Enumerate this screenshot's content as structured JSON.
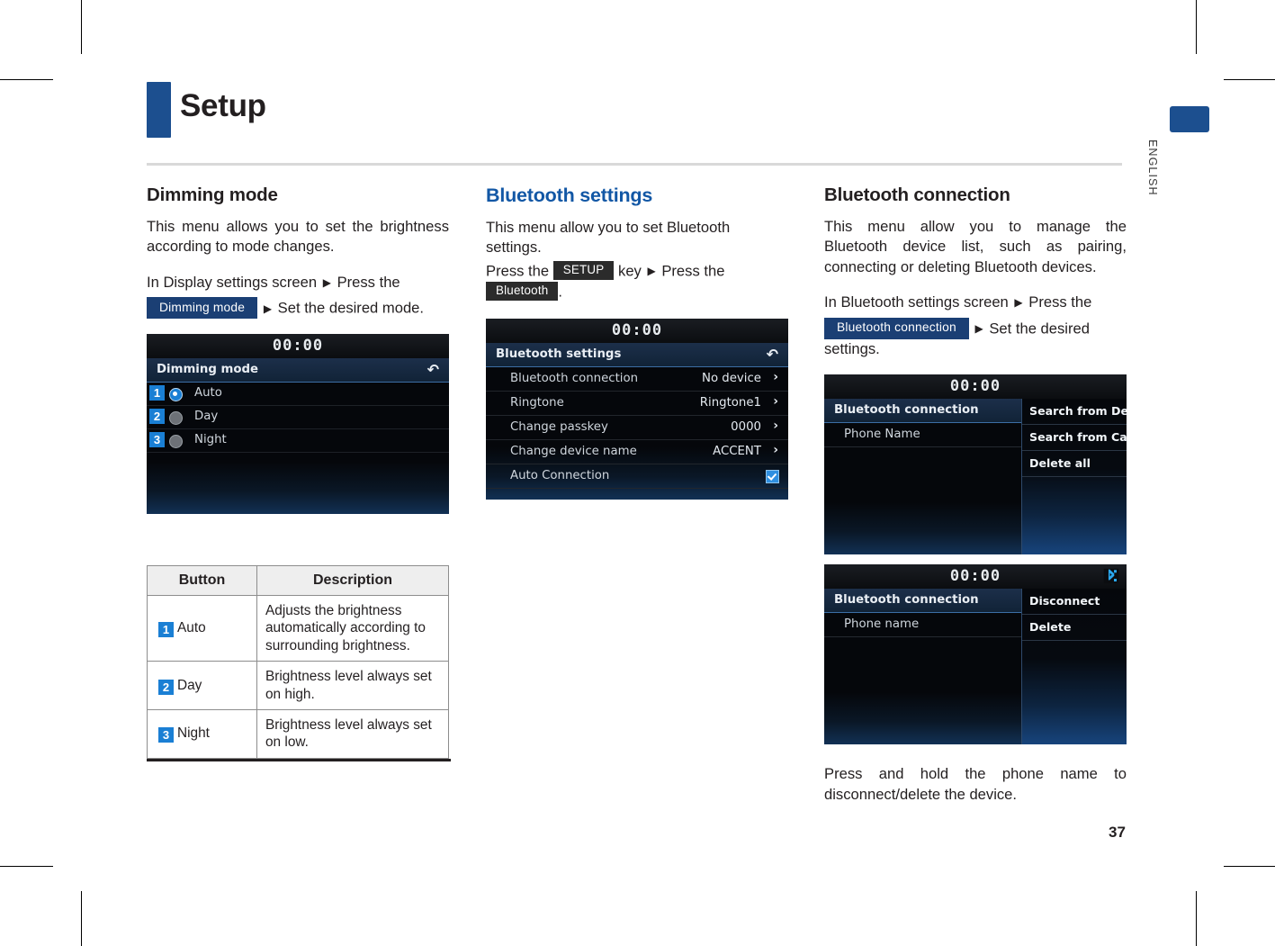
{
  "header": {
    "title": "Setup",
    "language_tab": "ENGLISH"
  },
  "page_number": "37",
  "columns": {
    "left": {
      "heading": "Dimming mode",
      "intro": "This menu allows you to set the brightness according to mode changes.",
      "path_line1": "In Display settings screen",
      "path_chip": "Dimming mode",
      "path_line2": "Press the",
      "path_line3": "Set the desired mode.",
      "screen": {
        "clock": "00:00",
        "title": "Dimming mode",
        "back_icon": "back-arrow-icon",
        "options": [
          {
            "badge": "1",
            "label": "Auto",
            "selected": true
          },
          {
            "badge": "2",
            "label": "Day",
            "selected": false
          },
          {
            "badge": "3",
            "label": "Night",
            "selected": false
          }
        ]
      },
      "table": {
        "headers": [
          "Button",
          "Description"
        ],
        "rows": [
          {
            "badge": "1",
            "button": "Auto",
            "description": "Adjusts the brightness automatically according to surrounding brightness."
          },
          {
            "badge": "2",
            "button": "Day",
            "description": "Brightness level always set on high."
          },
          {
            "badge": "3",
            "button": "Night",
            "description": "Brightness level always set on low."
          }
        ]
      }
    },
    "middle": {
      "heading": "Bluetooth settings",
      "intro": "This menu allow you to set Bluetooth settings.",
      "press_the": "Press the",
      "setup_key": "SETUP",
      "key_word": "key",
      "press_the2": "Press the",
      "bluetooth_chip": "Bluetooth",
      "period": ".",
      "screen": {
        "clock": "00:00",
        "title": "Bluetooth settings",
        "back_icon": "back-arrow-icon",
        "rows": [
          {
            "label": "Bluetooth connection",
            "value": "No device",
            "control": "chevron"
          },
          {
            "label": "Ringtone",
            "value": "Ringtone1",
            "control": "chevron"
          },
          {
            "label": "Change passkey",
            "value": "0000",
            "control": "chevron"
          },
          {
            "label": "Change device name",
            "value": "ACCENT",
            "control": "chevron"
          },
          {
            "label": "Auto Connection",
            "value": "",
            "control": "checkbox-checked"
          }
        ]
      }
    },
    "right": {
      "heading": "Bluetooth connection",
      "intro": "This menu allow you to manage the Bluetooth device list, such as pairing, connecting or deleting Bluetooth devices.",
      "path_line1": "In Bluetooth settings screen",
      "path_line2": "Press the",
      "path_chip": "Bluetooth connection",
      "path_line3": "Set the desired settings.",
      "screen1": {
        "clock": "00:00",
        "title": "Bluetooth connection",
        "device": "Phone Name",
        "popup_items": [
          "Search from Device",
          "Search from Car",
          "Delete all"
        ]
      },
      "screen2": {
        "clock": "00:00",
        "title": "Bluetooth connection",
        "device": "Phone name",
        "status_icon": "bluetooth-icon",
        "popup_items": [
          "Disconnect",
          "Delete"
        ]
      },
      "footnote": "Press and hold the phone name to disconnect/delete the device."
    }
  },
  "colors": {
    "brand_navy": "#1c4f8f",
    "heading_blue": "#1257a5",
    "badge_blue": "#1a7fd4"
  }
}
